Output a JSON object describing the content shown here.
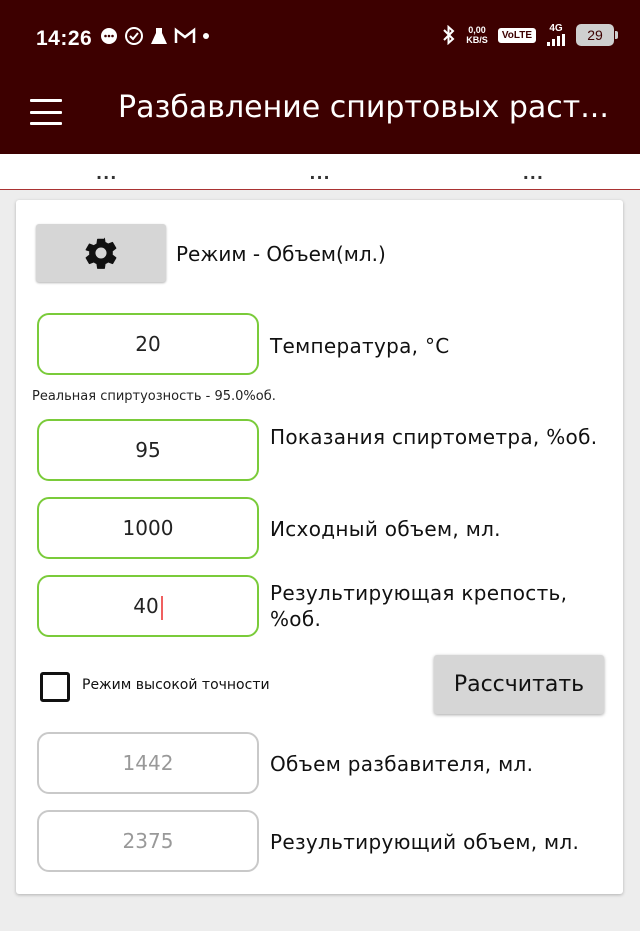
{
  "status_bar": {
    "time": "14:26",
    "net_speed_value": "0,00",
    "net_speed_unit": "KB/S",
    "volte": "VoLTE",
    "network": "4G",
    "battery": "29"
  },
  "app_bar": {
    "title": "Разбавление спиртовых раст..."
  },
  "tabs": [
    {
      "label": "..."
    },
    {
      "label": "..."
    },
    {
      "label": "..."
    }
  ],
  "form": {
    "mode_label": "Режим - Объем(мл.)",
    "temperature": {
      "value": "20",
      "label": "Температура, °С"
    },
    "real_strength": "Реальная спиртуозность - 95.0%об.",
    "hydrometer": {
      "value": "95",
      "label": "Показания спиртометра, %об."
    },
    "initial_volume": {
      "value": "1000",
      "label": "Исходный объем, мл."
    },
    "result_strength": {
      "value": "40",
      "label": "Результирующая крепость, %об."
    },
    "high_precision_label": "Режим высокой точности",
    "calculate_label": "Рассчитать",
    "diluent_volume": {
      "value": "1442",
      "label": "Объем разбавителя, мл."
    },
    "result_volume": {
      "value": "2375",
      "label": "Результирующий объем, мл."
    }
  },
  "colors": {
    "primary": "#3d0000",
    "field_border_active": "#7acb3a",
    "field_border_readonly": "#c9c9c9",
    "tab_indicator": "#aa3333"
  }
}
